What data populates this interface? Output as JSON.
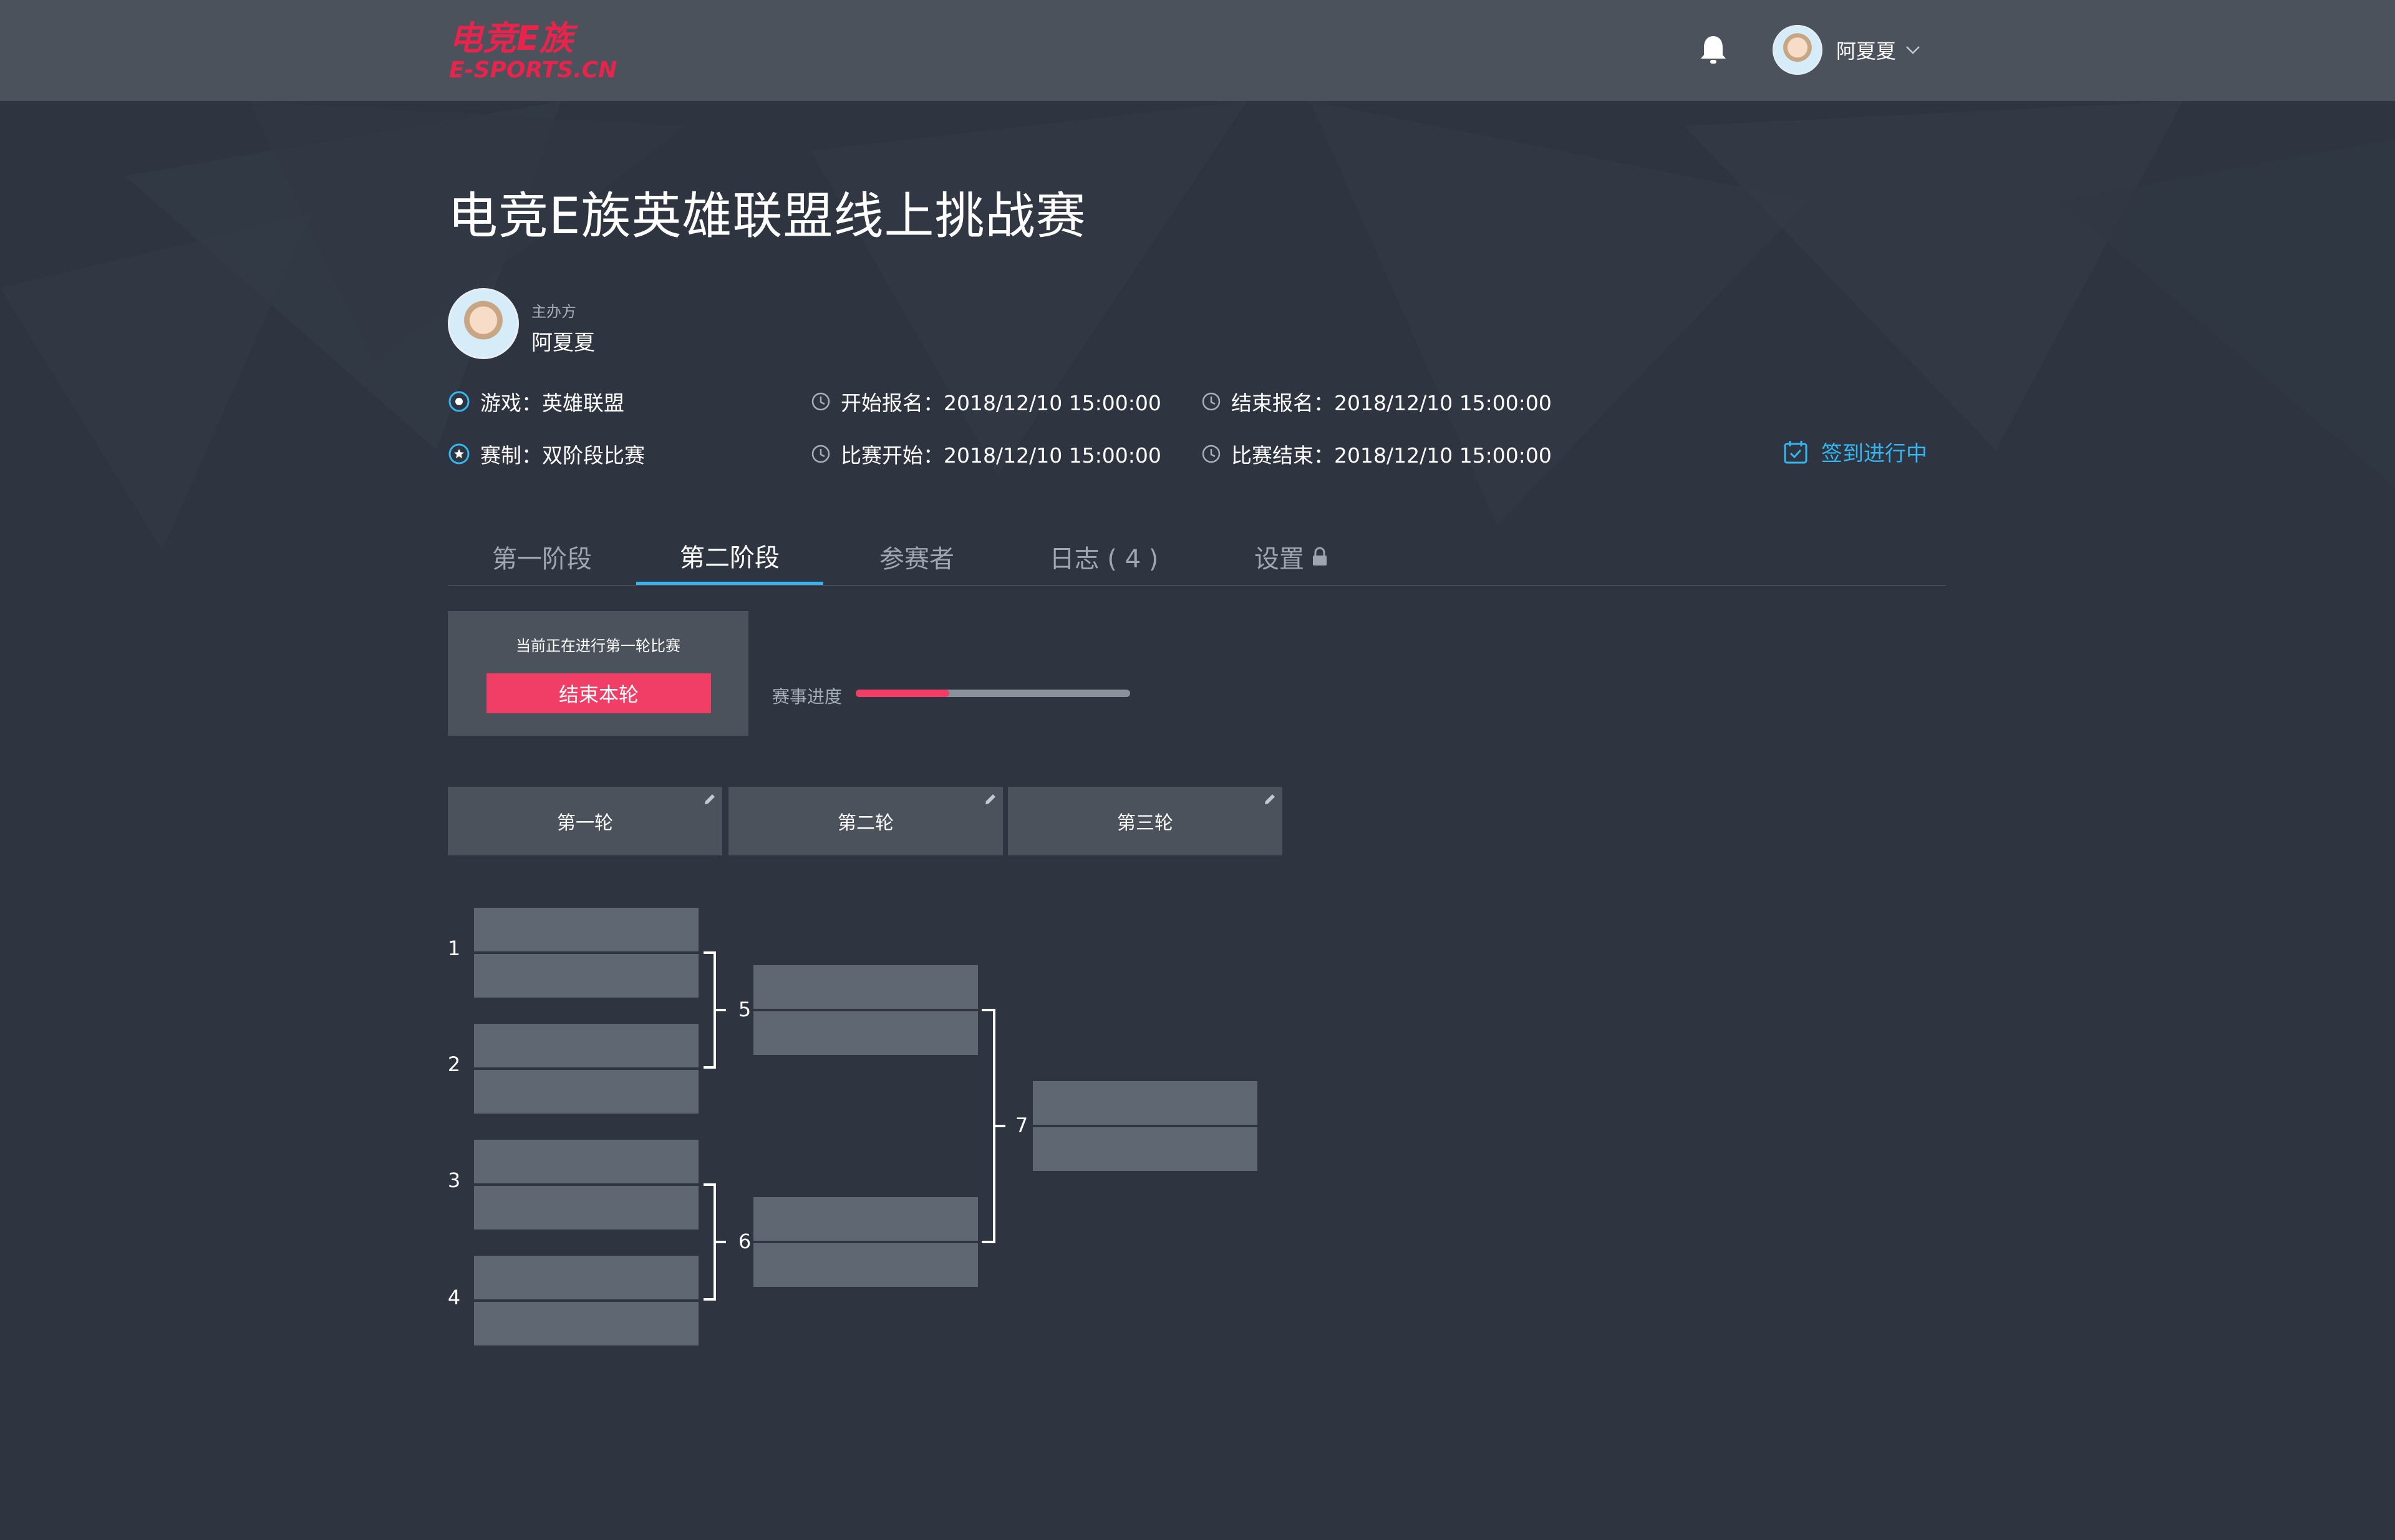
{
  "header": {
    "logo_text_cn": "电竞E族",
    "logo_text_en": "E-SPORTS.CN",
    "user_name": "阿夏夏"
  },
  "tournament": {
    "title": "电竞E族英雄联盟线上挑战赛",
    "organizer_label": "主办方",
    "organizer_name": "阿夏夏",
    "game": "游戏：英雄联盟",
    "format": "赛制：双阶段比赛",
    "registration_start": "开始报名：2018/12/10  15:00:00",
    "registration_end": "结束报名：2018/12/10  15:00:00",
    "match_start": "比赛开始：2018/12/10  15:00:00",
    "match_end": "比赛结束：2018/12/10  15:00:00",
    "status": "签到进行中"
  },
  "tabs": [
    "第一阶段",
    "第二阶段",
    "参赛者",
    "日志 ( 4 )",
    "设置"
  ],
  "active_tab": 1,
  "round_control": {
    "current_round_text": "当前正在进行第一轮比赛",
    "end_round_button": "结束本轮",
    "progress_label": "赛事进度",
    "progress_fraction": 0.34
  },
  "rounds": [
    "第一轮",
    "第二轮",
    "第三轮"
  ],
  "bracket": {
    "round1_matches": [
      "1",
      "2",
      "3",
      "4"
    ],
    "round2_matches": [
      "5",
      "6"
    ],
    "round3_matches": [
      "7"
    ]
  },
  "colors": {
    "background": "#2e3540",
    "header_bg": "#4b525c",
    "accent_blue": "#35b6f0",
    "accent_red": "#f03e66",
    "slot_bg": "#5f6772",
    "muted_text": "#a7afba"
  },
  "icons": {
    "bell": "bell-icon",
    "chevron": "chevron-down-icon",
    "game": "radio-target-icon",
    "format": "star-circle-icon",
    "clock": "clock-icon",
    "calendar_check": "calendar-check-icon",
    "lock": "lock-icon",
    "edit": "pencil-icon"
  }
}
